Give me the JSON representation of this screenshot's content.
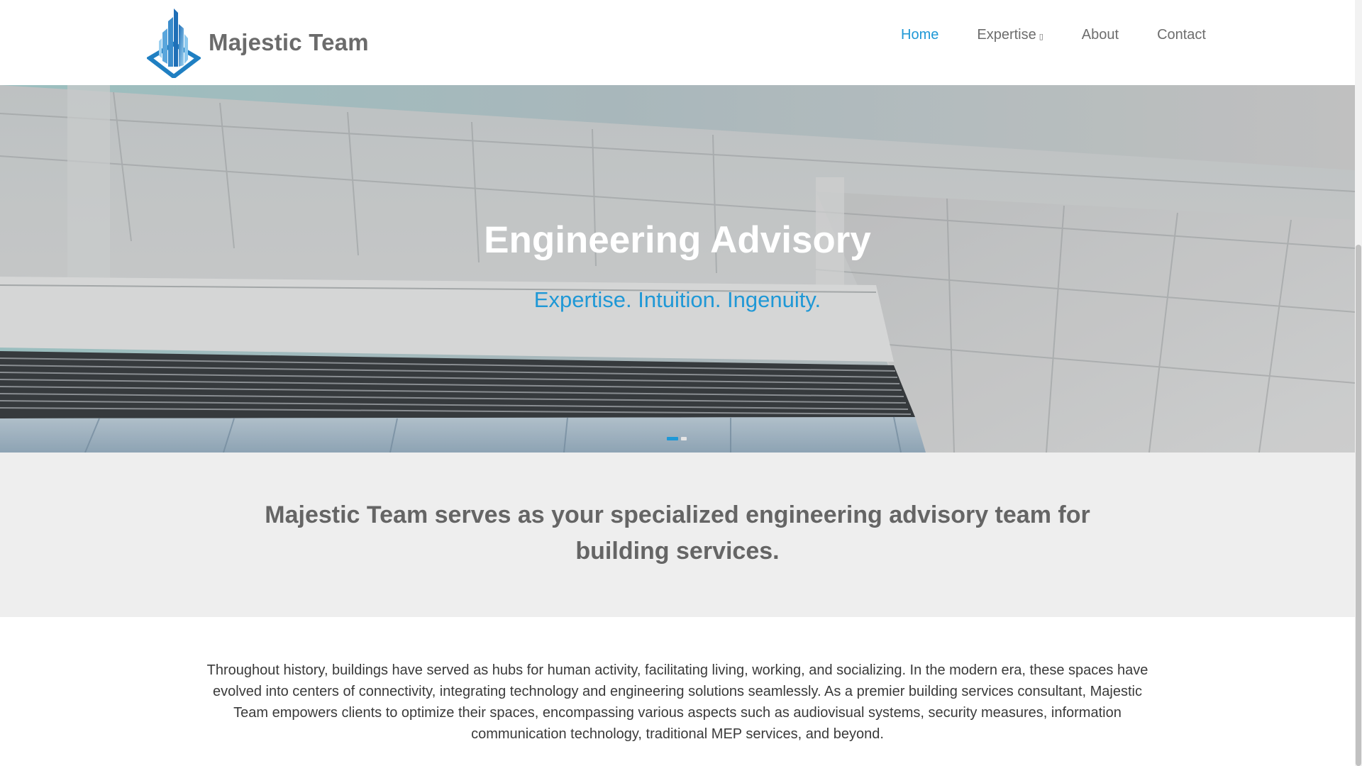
{
  "header": {
    "brand_name": "Majestic Team",
    "logo_icon": "building-diamond-logo",
    "nav": [
      {
        "label": "Home",
        "active": true
      },
      {
        "label": "Expertise",
        "has_dropdown": true,
        "caret_glyph": "▯"
      },
      {
        "label": "About"
      },
      {
        "label": "Contact"
      }
    ]
  },
  "hero": {
    "title": "Engineering Advisory",
    "subtitle": "Expertise. Intuition. Ingenuity.",
    "slides": {
      "count": 2,
      "active_index": 0
    }
  },
  "intro": {
    "text": "Majestic Team serves as your specialized engineering advisory team for building services."
  },
  "body": {
    "paragraph": "Throughout history, buildings have served as hubs for human activity, facilitating living, working, and socializing. In the modern era, these spaces have evolved into centers of connectivity, integrating technology and engineering solutions seamlessly. As a premier building services consultant, Majestic Team empowers clients to optimize their spaces, encompassing various aspects such as audiovisual systems, security measures, information communication technology, traditional MEP services, and beyond."
  },
  "colors": {
    "accent": "#1f98d6",
    "brand_text": "#6b6b6b",
    "intro_band": "#eeeeee"
  }
}
